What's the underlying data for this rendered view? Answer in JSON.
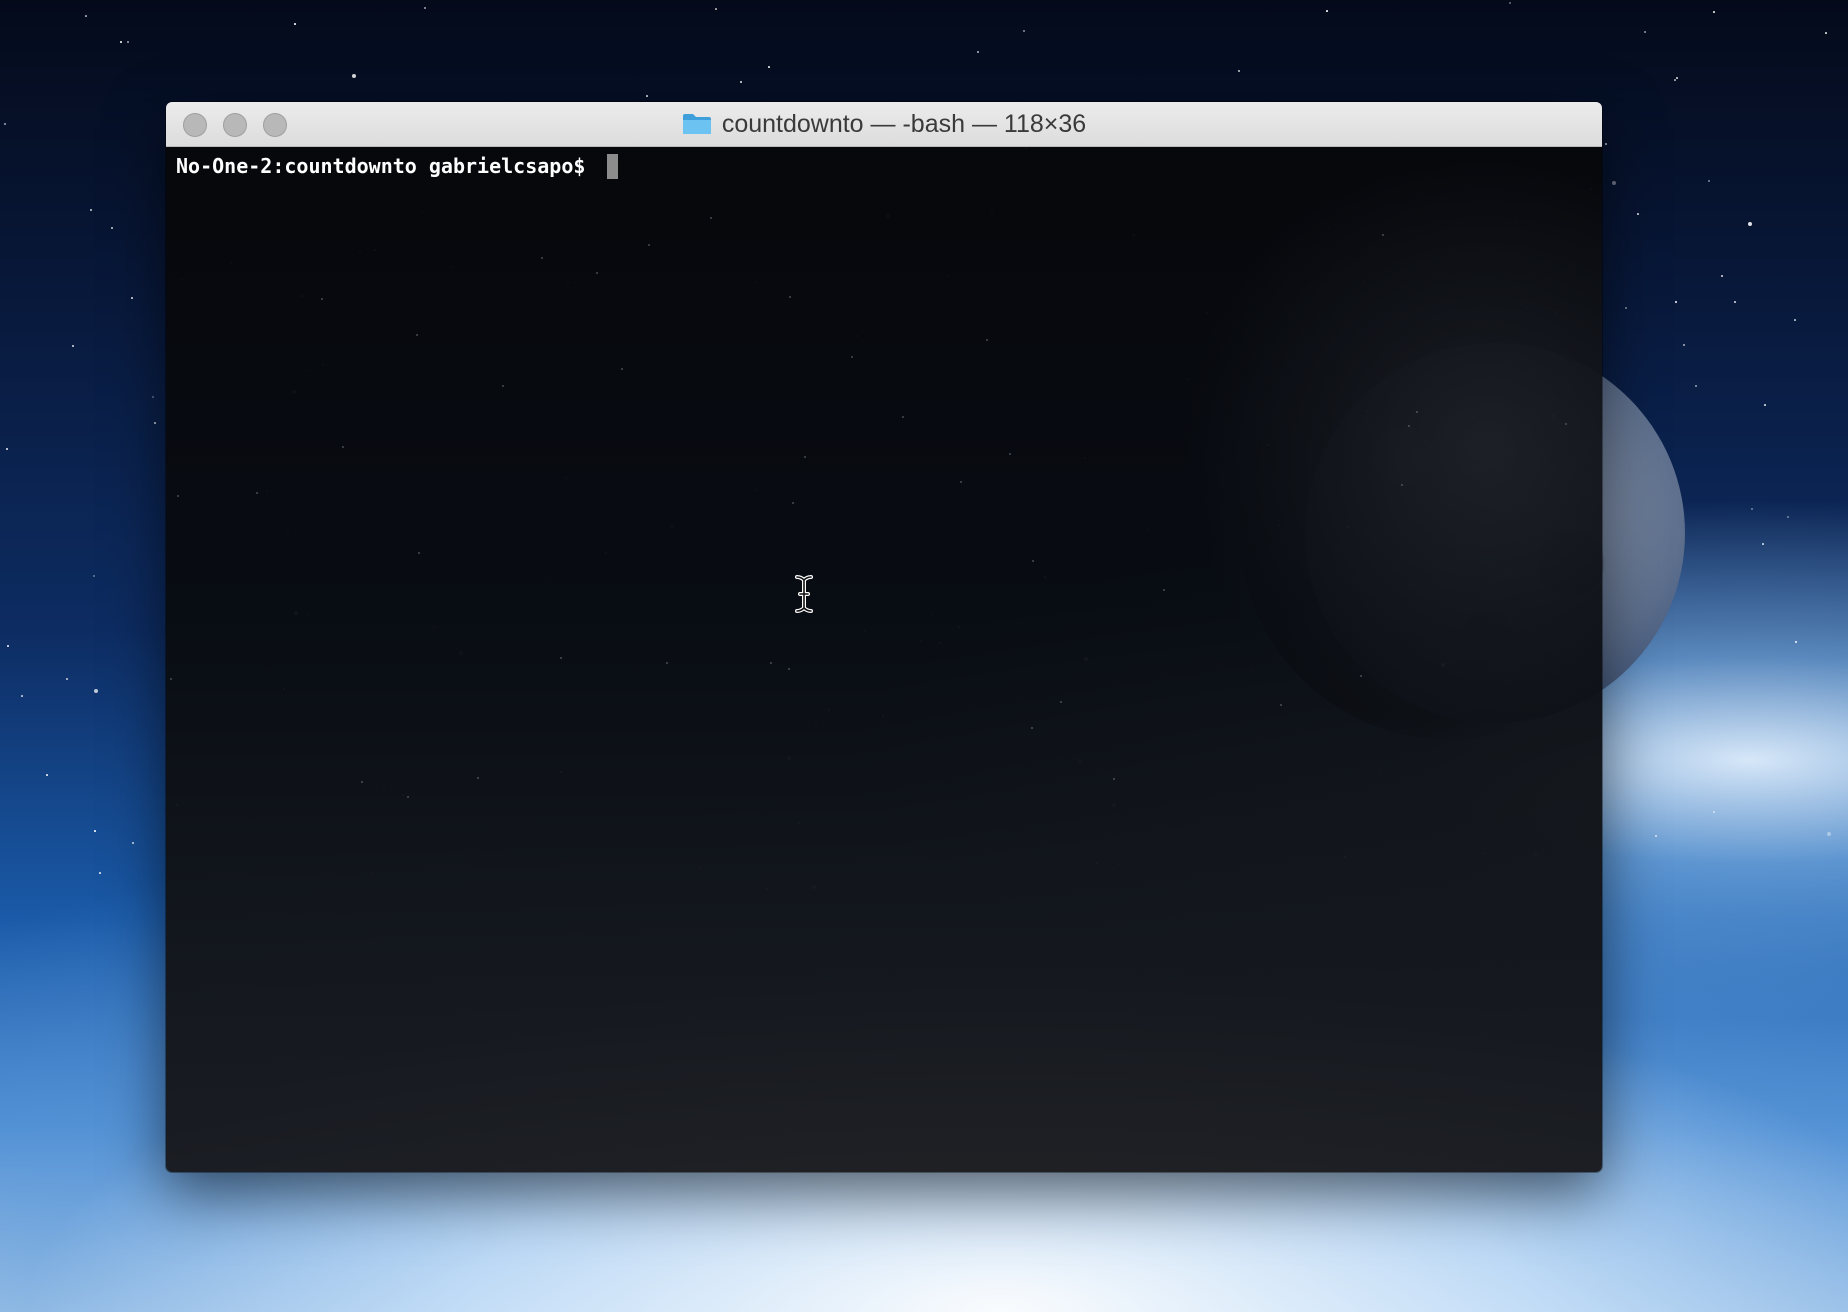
{
  "window": {
    "title": "countdownto — -bash — 118×36",
    "title_icon": "folder-icon",
    "controls": [
      "close",
      "minimize",
      "zoom"
    ]
  },
  "terminal": {
    "prompt": "No-One-2:countdownto gabrielcsapo$ ",
    "input": "",
    "cursor_style": "block"
  },
  "mouse_cursor": "ibeam-cursor-icon",
  "colors": {
    "titlebar": "#e3e3e3",
    "terminal_bg": "#0a0c10",
    "terminal_text": "#ffffff",
    "folder_icon": "#5ab4ea"
  }
}
